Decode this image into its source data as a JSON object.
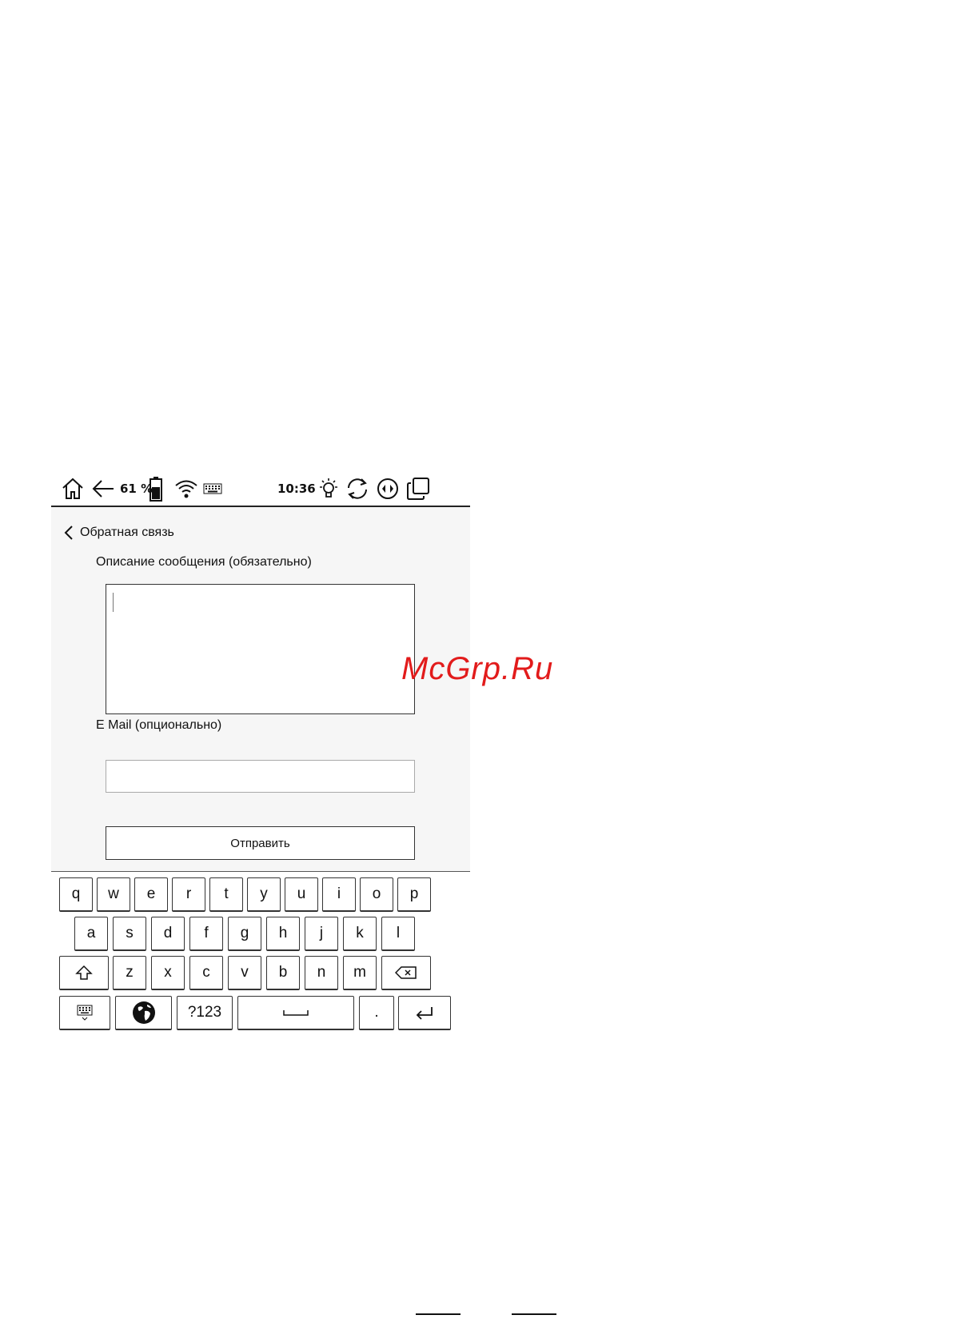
{
  "status_bar": {
    "battery_percent": "61 %",
    "time": "10:36",
    "icons": [
      "home-icon",
      "back-arrow-icon",
      "battery-icon",
      "wifi-icon",
      "keyboard-icon",
      "brightness-icon",
      "refresh-icon",
      "rotate-icon",
      "multitask-icon"
    ]
  },
  "header": {
    "title": "Обратная связь"
  },
  "form": {
    "description_label": "Описание сообщения (обязательно)",
    "description_value": "",
    "email_label": "E Mail (опционально)",
    "email_value": "",
    "submit_label": "Отправить"
  },
  "keyboard": {
    "row1": [
      "q",
      "w",
      "e",
      "r",
      "t",
      "y",
      "u",
      "i",
      "o",
      "p"
    ],
    "row2": [
      "a",
      "s",
      "d",
      "f",
      "g",
      "h",
      "j",
      "k",
      "l"
    ],
    "row3": [
      "z",
      "x",
      "c",
      "v",
      "b",
      "n",
      "m"
    ],
    "numbers_key": "?123",
    "period_key": "."
  },
  "watermark": "McGrp.Ru"
}
